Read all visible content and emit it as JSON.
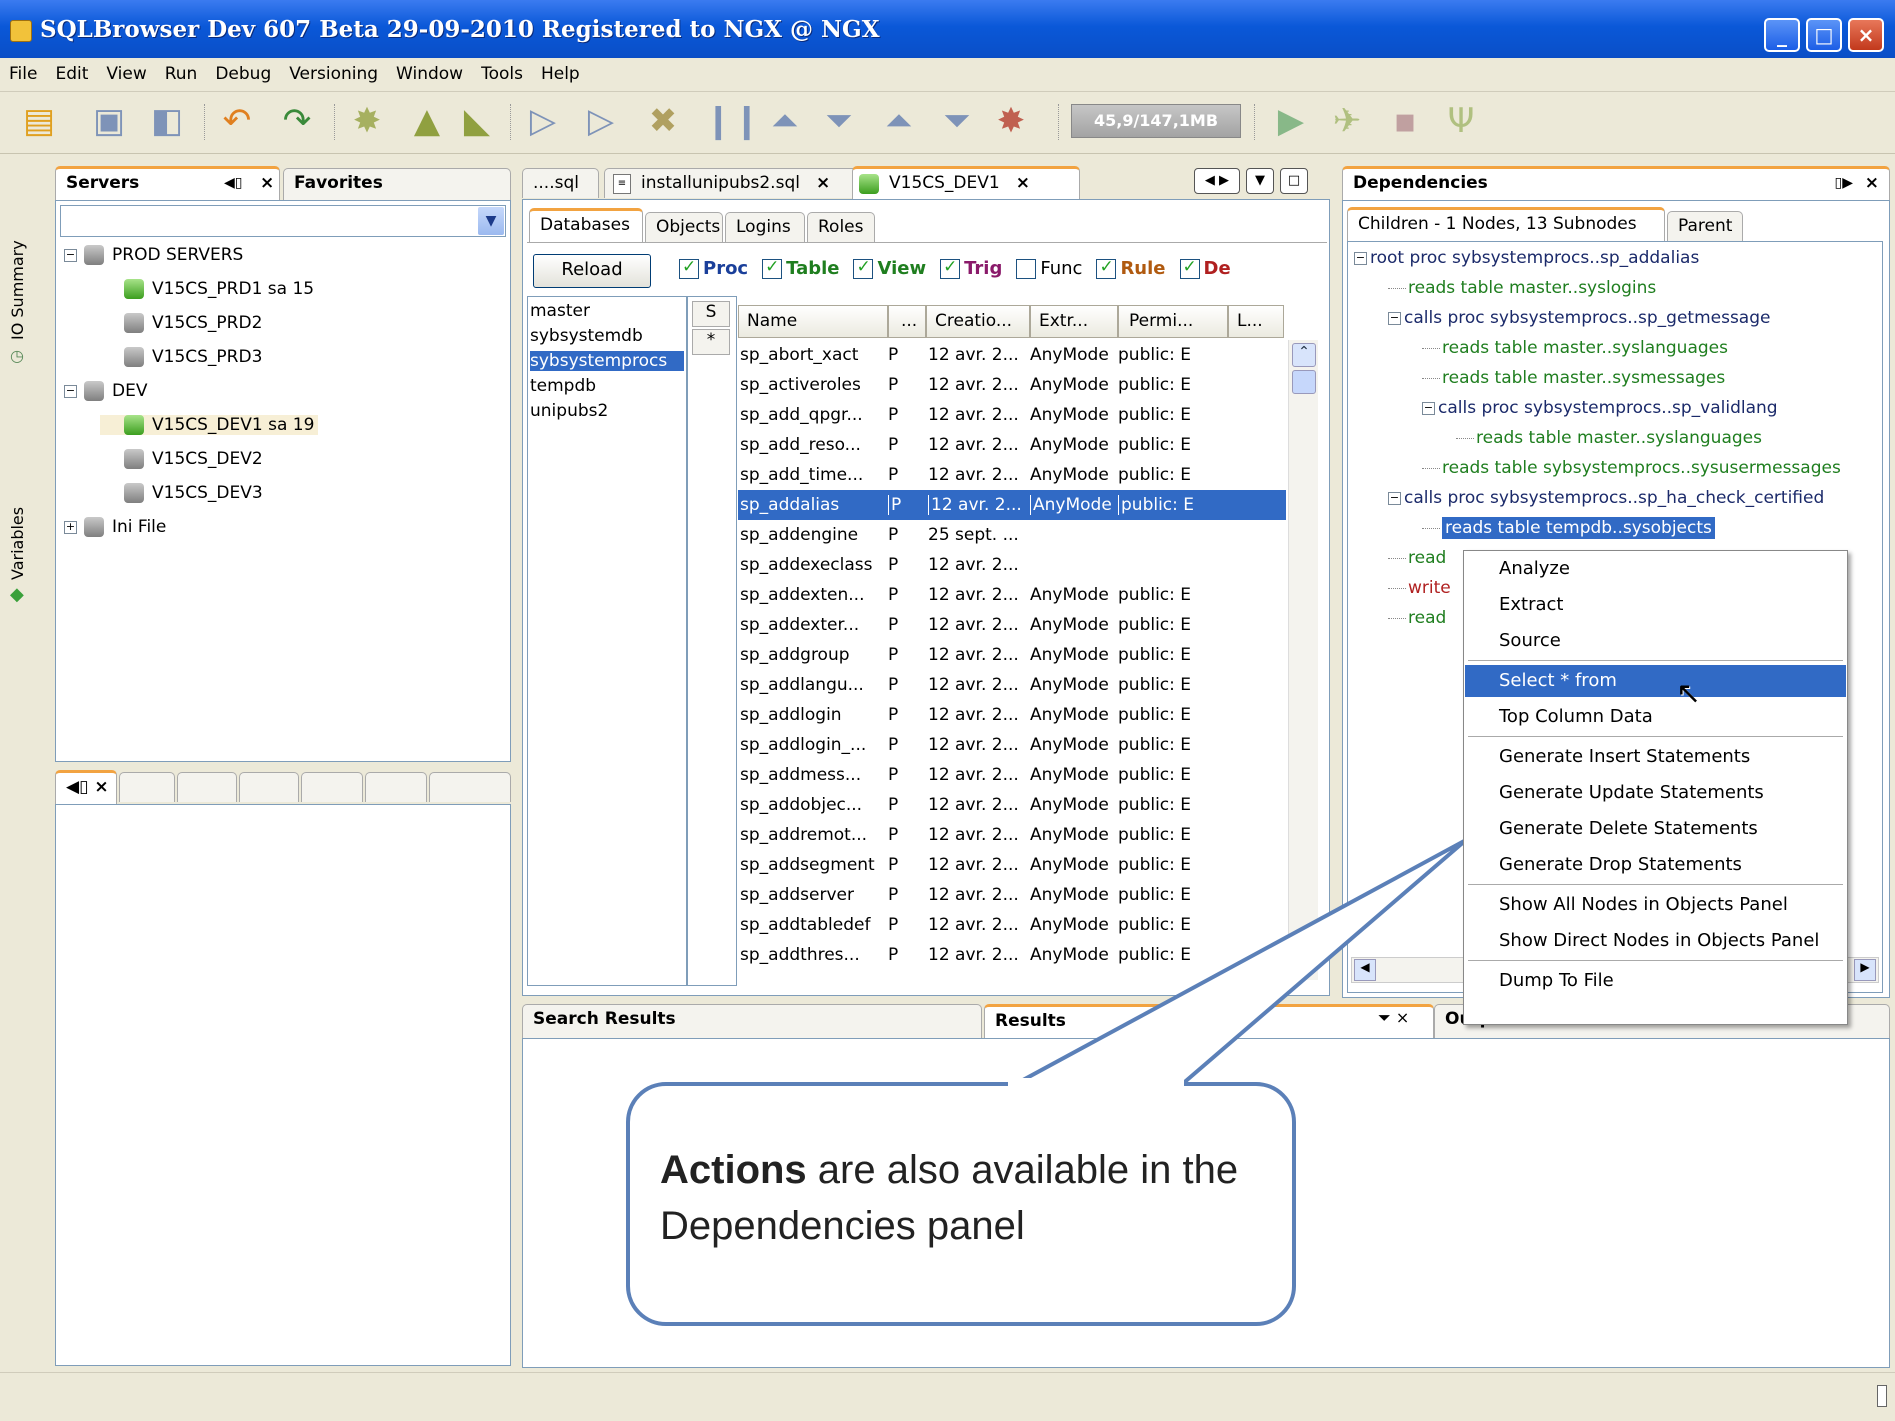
{
  "window": {
    "title": "SQLBrowser Dev 607 Beta  29-09-2010  Registered to NGX @ NGX",
    "minimize_glyph": "_",
    "maximize_glyph": "□",
    "close_glyph": "×"
  },
  "menu": [
    "File",
    "Edit",
    "View",
    "Run",
    "Debug",
    "Versioning",
    "Window",
    "Tools",
    "Help"
  ],
  "toolbar": {
    "memory": "45,9/147,1MB",
    "icons": [
      "new-file-icon",
      "save-icon",
      "save-all-icon",
      "undo-icon",
      "redo-icon",
      "build-icon",
      "deploy-icon",
      "run-icon",
      "step-into-icon",
      "step-over-icon",
      "stop-icon",
      "pause-icon",
      "up-icon",
      "down-icon",
      "up2-icon",
      "down2-icon",
      "clear-icon",
      "play-icon",
      "debug-icon",
      "halt-icon",
      "tree-icon"
    ]
  },
  "side_strip": {
    "io_summary": "IO Summary",
    "variables": "Variables"
  },
  "servers_panel": {
    "tab_servers": "Servers",
    "tab_favorites": "Favorites",
    "tree": [
      {
        "label": "PROD SERVERS",
        "level": 0,
        "expander": "−"
      },
      {
        "label": "V15CS_PRD1 sa 15",
        "level": 1,
        "active": true
      },
      {
        "label": "V15CS_PRD2",
        "level": 1
      },
      {
        "label": "V15CS_PRD3",
        "level": 1
      },
      {
        "label": "DEV",
        "level": 0,
        "expander": "−"
      },
      {
        "label": "V15CS_DEV1 sa 19",
        "level": 1,
        "active": true,
        "highlight": true
      },
      {
        "label": "V15CS_DEV2",
        "level": 1
      },
      {
        "label": "V15CS_DEV3",
        "level": 1
      },
      {
        "label": "Ini File",
        "level": 0,
        "expander": "+"
      }
    ]
  },
  "editor": {
    "tabs": [
      "....sql",
      "installunipubs2.sql",
      "V15CS_DEV1"
    ],
    "subtabs": [
      "Databases",
      "Objects",
      "Logins",
      "Roles"
    ],
    "reload": "Reload",
    "filters": [
      {
        "label": "Proc",
        "on": true,
        "color": "#1a3f9a"
      },
      {
        "label": "Table",
        "on": true,
        "color": "#1f7e1f"
      },
      {
        "label": "View",
        "on": true,
        "color": "#1f7e1f"
      },
      {
        "label": "Trig",
        "on": true,
        "color": "#8a1a6a"
      },
      {
        "label": "Func",
        "on": false,
        "color": "#000"
      },
      {
        "label": "Rule",
        "on": true,
        "color": "#b05a10"
      },
      {
        "label": "De",
        "on": true,
        "color": "#b02020"
      }
    ],
    "databases": [
      "master",
      "sybsystemdb",
      "sybsystemprocs",
      "tempdb",
      "unipubs2"
    ],
    "selected_db": "sybsystemprocs",
    "schema_col": [
      "S",
      "*"
    ],
    "columns": [
      "Name",
      "...",
      "Creatio...",
      "Extr...",
      "Permi...",
      "L..."
    ],
    "rows": [
      [
        "sp_abort_xact",
        "P",
        "12 avr. 2...",
        "AnyMode",
        "public: E"
      ],
      [
        "sp_activeroles",
        "P",
        "12 avr. 2...",
        "AnyMode",
        "public: E"
      ],
      [
        "sp_add_qpgr...",
        "P",
        "12 avr. 2...",
        "AnyMode",
        "public: E"
      ],
      [
        "sp_add_reso...",
        "P",
        "12 avr. 2...",
        "AnyMode",
        "public: E"
      ],
      [
        "sp_add_time...",
        "P",
        "12 avr. 2...",
        "AnyMode",
        "public: E"
      ],
      [
        "sp_addalias",
        "P",
        "12 avr. 2...",
        "AnyMode",
        "public: E"
      ],
      [
        "sp_addengine",
        "P",
        "25 sept. ...",
        "",
        ""
      ],
      [
        "sp_addexeclass",
        "P",
        "12 avr. 2...",
        "",
        ""
      ],
      [
        "sp_addexten...",
        "P",
        "12 avr. 2...",
        "AnyMode",
        "public: E"
      ],
      [
        "sp_addexter...",
        "P",
        "12 avr. 2...",
        "AnyMode",
        "public: E"
      ],
      [
        "sp_addgroup",
        "P",
        "12 avr. 2...",
        "AnyMode",
        "public: E"
      ],
      [
        "sp_addlangu...",
        "P",
        "12 avr. 2...",
        "AnyMode",
        "public: E"
      ],
      [
        "sp_addlogin",
        "P",
        "12 avr. 2...",
        "AnyMode",
        "public: E"
      ],
      [
        "sp_addlogin_...",
        "P",
        "12 avr. 2...",
        "AnyMode",
        "public: E"
      ],
      [
        "sp_addmess...",
        "P",
        "12 avr. 2...",
        "AnyMode",
        "public: E"
      ],
      [
        "sp_addobjec...",
        "P",
        "12 avr. 2...",
        "AnyMode",
        "public: E"
      ],
      [
        "sp_addremot...",
        "P",
        "12 avr. 2...",
        "AnyMode",
        "public: E"
      ],
      [
        "sp_addsegment",
        "P",
        "12 avr. 2...",
        "AnyMode",
        "public: E"
      ],
      [
        "sp_addserver",
        "P",
        "12 avr. 2...",
        "AnyMode",
        "public: E"
      ],
      [
        "sp_addtabledef",
        "P",
        "12 avr. 2...",
        "AnyMode",
        "public: E"
      ],
      [
        "sp_addthres...",
        "P",
        "12 avr. 2...",
        "AnyMode",
        "public: E"
      ]
    ],
    "selected_row": "sp_addalias"
  },
  "dependencies": {
    "title": "Dependencies",
    "tab_children": "Children - 1 Nodes, 13 Subnodes",
    "tab_parent": "Parent",
    "tree": [
      {
        "text": "root proc sybsystemprocs..sp_addalias",
        "level": 0,
        "color": "b",
        "expander": "−"
      },
      {
        "text": "reads table master..syslogins",
        "level": 1,
        "color": "g"
      },
      {
        "text": "calls proc sybsystemprocs..sp_getmessage",
        "level": 1,
        "color": "b",
        "expander": "−"
      },
      {
        "text": "reads table master..syslanguages",
        "level": 2,
        "color": "g"
      },
      {
        "text": "reads table master..sysmessages",
        "level": 2,
        "color": "g"
      },
      {
        "text": "calls proc sybsystemprocs..sp_validlang",
        "level": 2,
        "color": "b",
        "expander": "−"
      },
      {
        "text": "reads table master..syslanguages",
        "level": 3,
        "color": "g"
      },
      {
        "text": "reads table sybsystemprocs..sysusermessages",
        "level": 2,
        "color": "g"
      },
      {
        "text": "calls proc sybsystemprocs..sp_ha_check_certified",
        "level": 1,
        "color": "b",
        "expander": "−"
      },
      {
        "text": "reads table tempdb..sysobjects",
        "level": 2,
        "color": "g",
        "selected": true
      },
      {
        "text": "read",
        "level": 1,
        "color": "g"
      },
      {
        "text": "write",
        "level": 1,
        "color": "r"
      },
      {
        "text": "read",
        "level": 1,
        "color": "g"
      }
    ]
  },
  "context_menu": [
    {
      "label": "Analyze"
    },
    {
      "label": "Extract"
    },
    {
      "label": "Source",
      "sep_after": true
    },
    {
      "label": "Select * from",
      "selected": true
    },
    {
      "label": "Top Column Data",
      "sep_after": true
    },
    {
      "label": "Generate Insert Statements"
    },
    {
      "label": "Generate Update Statements"
    },
    {
      "label": "Generate Delete Statements"
    },
    {
      "label": "Generate Drop Statements",
      "sep_after": true
    },
    {
      "label": "Show All Nodes in Objects Panel"
    },
    {
      "label": "Show Direct Nodes in Objects Panel",
      "sep_after": true
    },
    {
      "label": "Dump To File"
    }
  ],
  "bottom_tabs": {
    "search_results": "Search Results",
    "results": "Results",
    "output": "Output"
  },
  "callout": {
    "bold": "Actions",
    "text": " are also available in the Dependencies panel"
  }
}
